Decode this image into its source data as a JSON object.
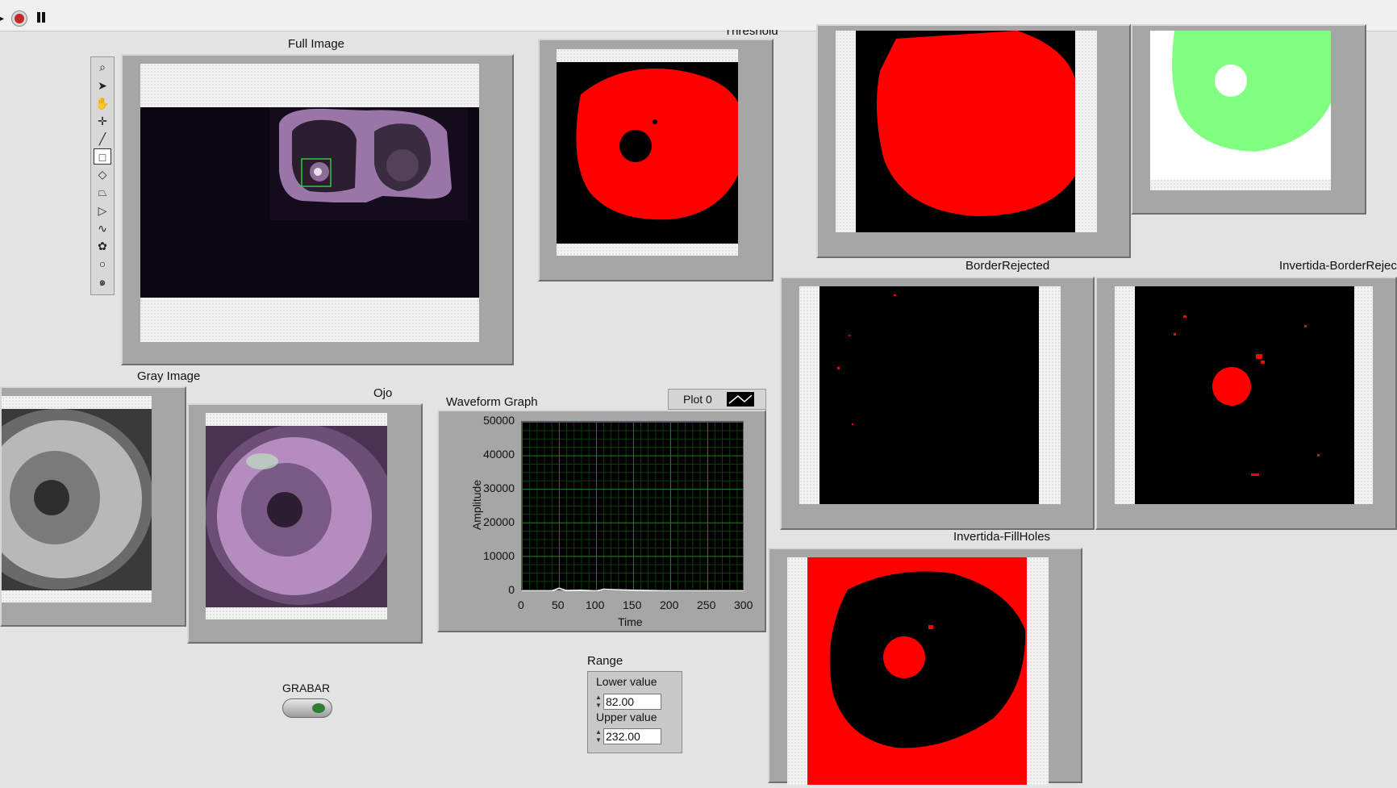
{
  "toolbar": {
    "run_stop": "stop-icon",
    "pause": "pause-icon"
  },
  "indicators": {
    "full_image": "Full Image",
    "threshold": "Threshold",
    "border_rejected": "BorderRejected",
    "invertida_border_rejected": "Invertida-BorderReject",
    "gray_image": "Gray Image",
    "ojo": "Ojo",
    "invertida_fill_holes": "Invertida-FillHoles"
  },
  "image_tools": [
    "zoom-icon",
    "pointer-icon",
    "pan-icon",
    "crosshair-icon",
    "line-icon",
    "rectangle-icon",
    "rotated-rect-icon",
    "polygon-icon",
    "freehand-icon",
    "broken-line-icon",
    "annulus-icon",
    "oval-icon",
    "spiral-icon"
  ],
  "graph": {
    "title": "Waveform Graph",
    "legend_label": "Plot 0",
    "ylabel": "Amplitude",
    "xlabel": "Time",
    "yticks": [
      "50000",
      "40000",
      "30000",
      "20000",
      "10000",
      "0"
    ],
    "xticks": [
      "0",
      "50",
      "100",
      "150",
      "200",
      "250",
      "300"
    ]
  },
  "chart_data": {
    "type": "line",
    "title": "Waveform Graph",
    "xlabel": "Time",
    "ylabel": "Amplitude",
    "xlim": [
      0,
      300
    ],
    "ylim": [
      0,
      50000
    ],
    "grid": true,
    "legend": "top-right",
    "series": [
      {
        "name": "Plot 0",
        "x": [
          0,
          40,
          50,
          60,
          80,
          100,
          110,
          130,
          150,
          200,
          300
        ],
        "values": [
          0,
          0,
          900,
          200,
          300,
          0,
          600,
          400,
          300,
          0,
          0
        ]
      }
    ]
  },
  "range": {
    "title": "Range",
    "lower_label": "Lower value",
    "lower_value": "82.00",
    "upper_label": "Upper value",
    "upper_value": "232.00"
  },
  "grabar": {
    "label": "GRABAR"
  },
  "colors": {
    "mask_red": "#ff0000",
    "mask_green": "#80ff80",
    "background": "#e3e3e3"
  }
}
